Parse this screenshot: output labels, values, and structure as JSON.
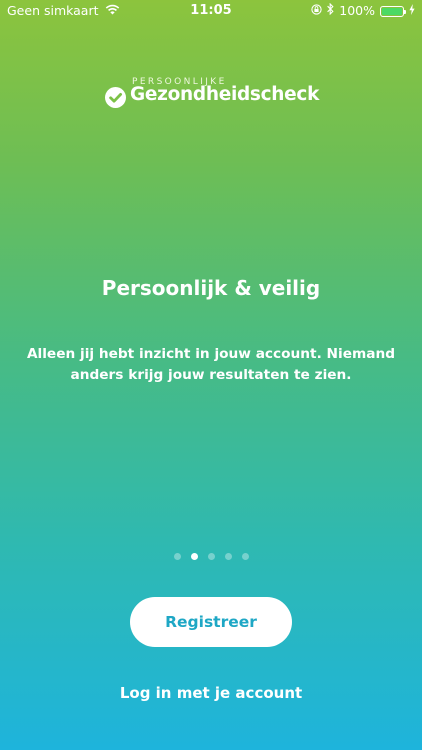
{
  "status_bar": {
    "carrier": "Geen simkaart",
    "time": "11:05",
    "battery_percent": "100%",
    "battery_level": 1.0,
    "battery_color": "#4cd964",
    "icons": [
      "wifi-icon",
      "orientation-lock-icon",
      "bluetooth-icon",
      "battery-icon",
      "charging-icon"
    ]
  },
  "logo": {
    "small_text": "PERSOONLIJKE",
    "main_text": "Gezondheidscheck",
    "icon": "checkmark-circle-icon"
  },
  "onboarding": {
    "title": "Persoonlijk & veilig",
    "body": "Alleen jij hebt inzicht in jouw account. Niemand anders krijg jouw resultaten te zien.",
    "page_count": 5,
    "active_page": 2
  },
  "actions": {
    "register_label": "Registreer",
    "login_label": "Log in met je account"
  },
  "colors": {
    "gradient_top": "#8cc43d",
    "gradient_bottom": "#1eb4dc",
    "button_text": "#1ea7c5"
  }
}
